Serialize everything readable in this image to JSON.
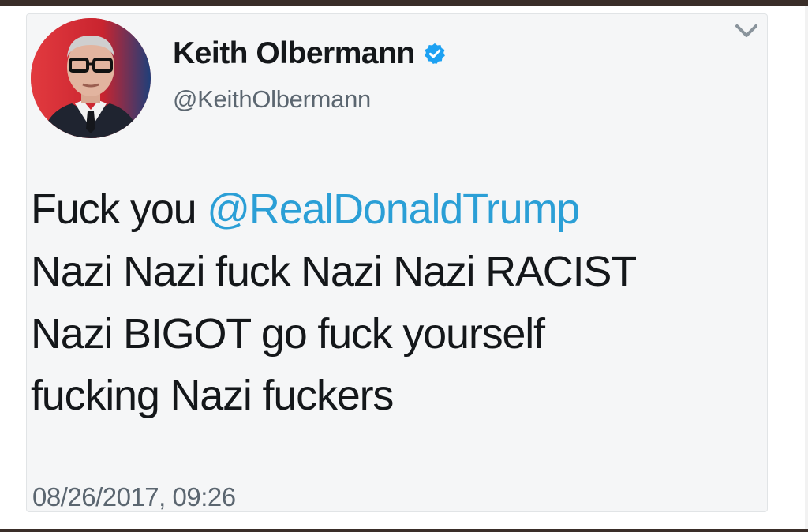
{
  "tweet": {
    "author": {
      "display_name": "Keith Olbermann",
      "handle": "@KeithOlbermann",
      "verified": true,
      "verified_icon": "verified-badge-icon",
      "avatar_icon": "profile-photo"
    },
    "menu_icon": "chevron-down-icon",
    "text": {
      "line1_prefix": "Fuck you ",
      "mention": "@RealDonaldTrump",
      "line2": "Nazi Nazi fuck Nazi Nazi RACIST",
      "line3": "Nazi BIGOT go fuck yourself",
      "line4": "fucking Nazi fuckers"
    },
    "timestamp": "08/26/2017, 09:26"
  },
  "colors": {
    "text": "#14171a",
    "secondary_text": "#5b6670",
    "mention": "#2b9fd6",
    "verified": "#1da1f2",
    "card_background": "#f5f6f7",
    "frame": "#3a2e29"
  }
}
